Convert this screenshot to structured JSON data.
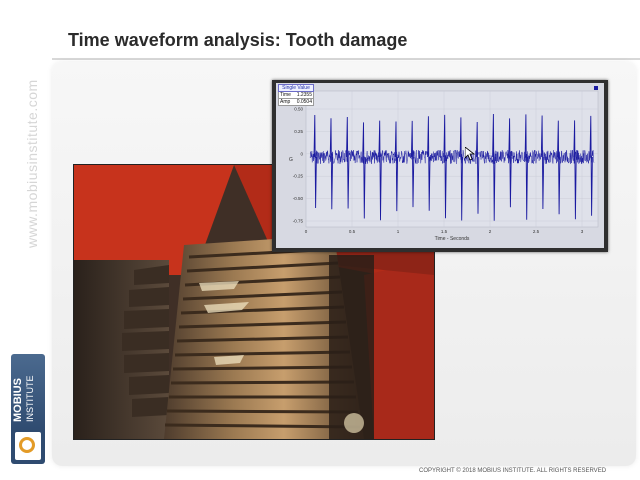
{
  "slide": {
    "title": "Time waveform analysis: Tooth damage",
    "side_watermark": "www.mobiusinstitute.com",
    "logo": {
      "line1": "MOBIUS",
      "line2": "INSTITUTE"
    },
    "copyright": "COPYRIGHT © 2018  MOBIUS INSTITUTE.  ALL RIGHTS RESERVED"
  },
  "waveform": {
    "readout": {
      "header": "Single Value",
      "rows": [
        {
          "label": "Time",
          "value": "1.2355"
        },
        {
          "label": "Amp",
          "value": "0.0504"
        }
      ]
    },
    "x_ticks": [
      "0",
      "0.5",
      "1",
      "1.5",
      "2",
      "2.5",
      "3"
    ],
    "y_ticks": [
      "0.50",
      "0.25",
      "0",
      "-0.25",
      "-0.50",
      "-0.75"
    ],
    "y_unit": "G",
    "x_label": "Time - Seconds"
  },
  "colors": {
    "accent": "#e39b27",
    "trace": "#1a1aa0",
    "logo_blue": "#3d5a80"
  }
}
